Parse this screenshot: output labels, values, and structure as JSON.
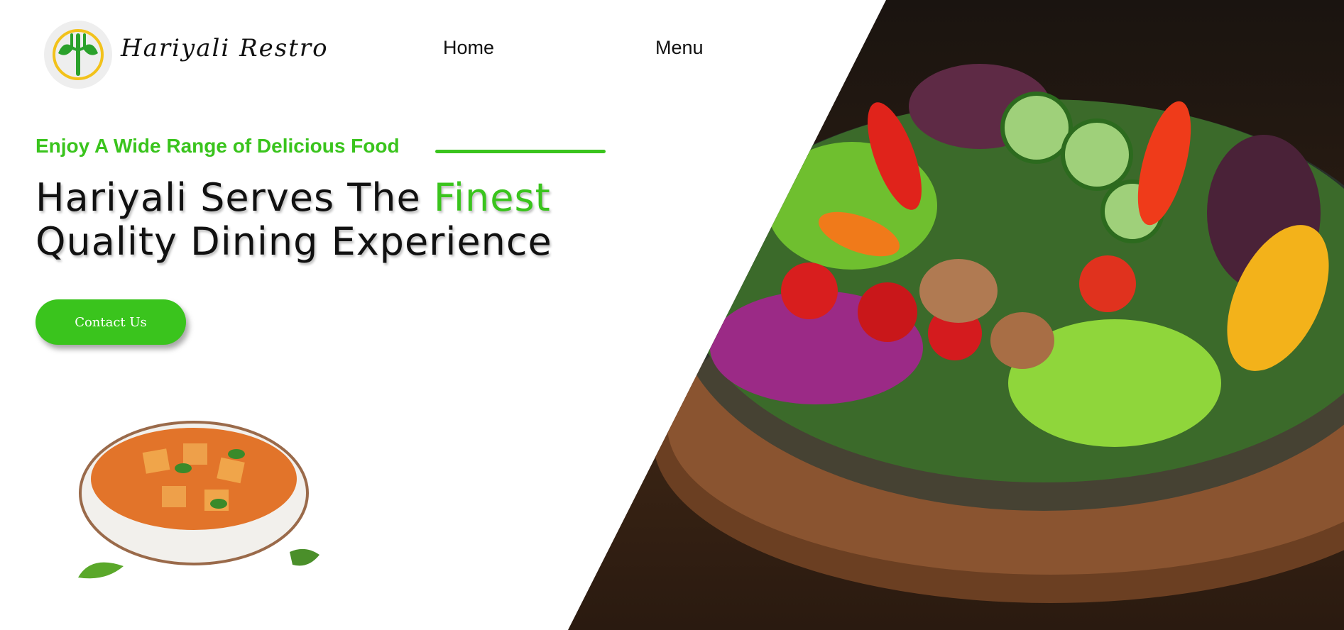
{
  "header": {
    "brand_name": "Hariyali Restro",
    "logo_icon": "fork-leaf-icon",
    "nav": [
      {
        "label": "Home"
      },
      {
        "label": "Menu"
      }
    ]
  },
  "hero": {
    "eyebrow": "Enjoy A Wide Range of Delicious Food",
    "headline_part1": "Hariyali Serves The ",
    "headline_accent": "Finest",
    "headline_part2": "Quality Dining Experience",
    "cta_label": "Contact Us"
  },
  "colors": {
    "accent": "#3ac41d",
    "text": "#111111",
    "background": "#ffffff"
  }
}
